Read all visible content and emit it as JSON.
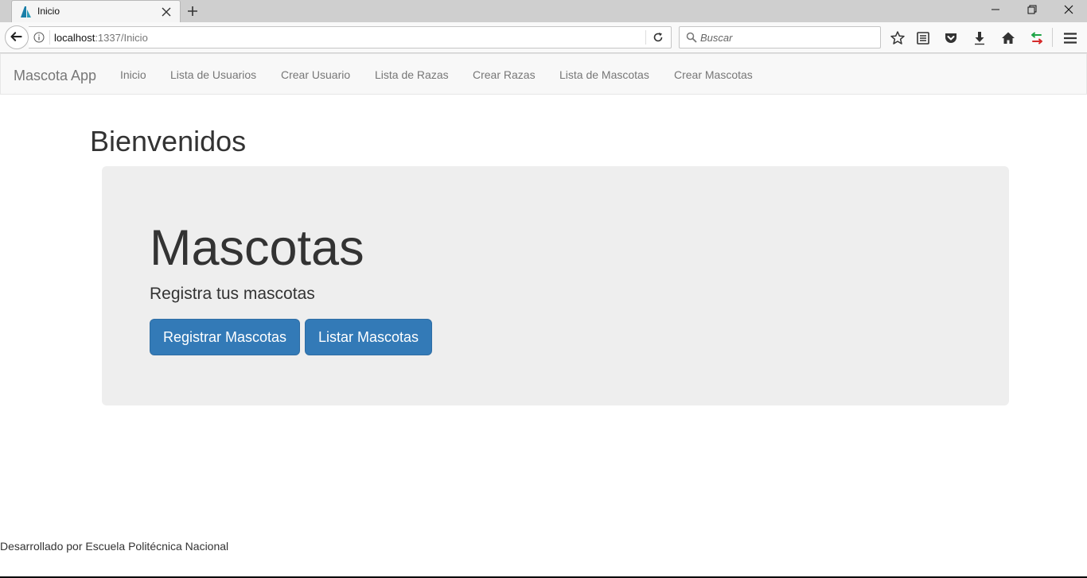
{
  "browser": {
    "tab": {
      "title": "Inicio",
      "favicon": "app-favicon"
    },
    "url": {
      "host": "localhost",
      "rest": ":1337/Inicio"
    },
    "search": {
      "placeholder": "Buscar"
    },
    "toolbar_icons": [
      "star-icon",
      "reading-list-icon",
      "pocket-icon",
      "download-icon",
      "home-icon",
      "sync-arrows-icon",
      "hamburger-menu-icon"
    ]
  },
  "app": {
    "brand": "Mascota App",
    "nav": [
      {
        "label": "Inicio"
      },
      {
        "label": "Lista de Usuarios"
      },
      {
        "label": "Crear Usuario"
      },
      {
        "label": "Lista de Razas"
      },
      {
        "label": "Crear Razas"
      },
      {
        "label": "Lista de Mascotas"
      },
      {
        "label": "Crear Mascotas"
      }
    ]
  },
  "main": {
    "title": "Bienvenidos",
    "jumbotron": {
      "title": "Mascotas",
      "subtitle": "Registra tus mascotas",
      "buttons": {
        "register": "Registrar Mascotas",
        "list": "Listar Mascotas"
      }
    }
  },
  "footer": {
    "text": "Desarrollado por Escuela Politécnica Nacional"
  },
  "colors": {
    "primary": "#337ab7",
    "jumbotron": "#eeeeee",
    "nav_bg": "#f8f8f8"
  }
}
